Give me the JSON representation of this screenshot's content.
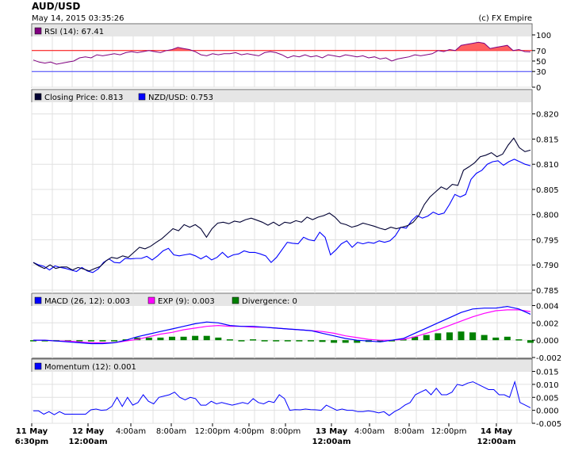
{
  "header": {
    "symbol": "AUD/USD",
    "timestamp": "May 14, 2015 03:35:26",
    "copyright": "(c) FX Empire"
  },
  "panels": {
    "rsi": {
      "legend": "RSI (14): 67.41",
      "ticks": [
        "100",
        "70",
        "50",
        "30",
        "0"
      ],
      "range": [
        0,
        100
      ],
      "levels": [
        70,
        30
      ],
      "colors": {
        "line": "#800080",
        "fill": "#ff6060",
        "upper_level": "#ff0000",
        "lower_level": "#4040ff",
        "swatch": "#800080"
      }
    },
    "price": {
      "legend_closing": "Closing Price: 0.813",
      "legend_nzd": "NZD/USD: 0.753",
      "ticks": [
        "0.820",
        "0.815",
        "0.810",
        "0.805",
        "0.800",
        "0.795",
        "0.790",
        "0.785"
      ],
      "range": [
        0.785,
        0.822
      ],
      "colors": {
        "closing": "#000033",
        "nzd": "#0000ff"
      }
    },
    "macd": {
      "legend_macd": "MACD (26, 12): 0.003",
      "legend_exp": "EXP (9): 0.003",
      "legend_div": "Divergence: 0",
      "ticks": [
        "0.004",
        "0.002",
        "0.000",
        "-0.002"
      ],
      "range": [
        -0.002,
        0.0045
      ],
      "colors": {
        "macd": "#0000ff",
        "exp": "#ff00ff",
        "divergence": "#008000"
      }
    },
    "momentum": {
      "legend": "Momentum (12): 0.001",
      "ticks": [
        "0.015",
        "0.010",
        "0.005",
        "0.000",
        "-0.005"
      ],
      "range": [
        -0.005,
        0.017
      ],
      "colors": {
        "line": "#0000ff"
      }
    }
  },
  "x_axis": {
    "labels": [
      {
        "line1": "11 May",
        "line2": "6:30pm",
        "bold": true
      },
      {
        "line1": "12 May",
        "line2": "12:00am",
        "bold": true
      },
      {
        "line1": "4:00am",
        "line2": "",
        "bold": false
      },
      {
        "line1": "8:00am",
        "line2": "",
        "bold": false
      },
      {
        "line1": "12:00pm",
        "line2": "",
        "bold": false
      },
      {
        "line1": "4:00pm",
        "line2": "",
        "bold": false
      },
      {
        "line1": "8:00pm",
        "line2": "",
        "bold": false
      },
      {
        "line1": "13 May",
        "line2": "12:00am",
        "bold": true
      },
      {
        "line1": "4:00am",
        "line2": "",
        "bold": false
      },
      {
        "line1": "8:00am",
        "line2": "",
        "bold": false
      },
      {
        "line1": "12:00pm",
        "line2": "",
        "bold": false
      },
      {
        "line1": "14 May",
        "line2": "12:00am",
        "bold": true
      }
    ]
  },
  "chart_data": [
    {
      "type": "line",
      "title": "RSI (14): 67.41",
      "ylim": [
        0,
        100
      ],
      "series": [
        {
          "name": "RSI (14)",
          "values": [
            52,
            48,
            46,
            48,
            44,
            46,
            48,
            50,
            56,
            58,
            56,
            62,
            60,
            62,
            64,
            62,
            66,
            68,
            66,
            68,
            70,
            68,
            66,
            70,
            72,
            76,
            74,
            72,
            68,
            62,
            60,
            64,
            62,
            64,
            64,
            66,
            62,
            64,
            62,
            60,
            66,
            68,
            66,
            62,
            56,
            60,
            58,
            62,
            58,
            60,
            56,
            62,
            60,
            58,
            62,
            60,
            58,
            60,
            56,
            58,
            54,
            56,
            50,
            54,
            56,
            58,
            62,
            60,
            62,
            64,
            70,
            68,
            72,
            70,
            80,
            82,
            84,
            86,
            84,
            74,
            76,
            78,
            80,
            70,
            72,
            68,
            67.41
          ]
        }
      ]
    },
    {
      "type": "line",
      "title": "Closing Price: 0.813",
      "ylim": [
        0.785,
        0.822
      ],
      "series": [
        {
          "name": "Closing Price",
          "values": [
            0.7905,
            0.7898,
            0.7893,
            0.79,
            0.7893,
            0.7896,
            0.7896,
            0.789,
            0.7895,
            0.7892,
            0.7888,
            0.7893,
            0.7897,
            0.7908,
            0.7915,
            0.7913,
            0.7918,
            0.7915,
            0.7925,
            0.7935,
            0.7932,
            0.7937,
            0.7945,
            0.7952,
            0.7962,
            0.7972,
            0.7968,
            0.798,
            0.7975,
            0.798,
            0.7972,
            0.7955,
            0.7972,
            0.7983,
            0.7985,
            0.7982,
            0.7987,
            0.7985,
            0.799,
            0.7993,
            0.7989,
            0.7985,
            0.7979,
            0.7985,
            0.7978,
            0.7985,
            0.7983,
            0.7988,
            0.7985,
            0.7995,
            0.799,
            0.7995,
            0.7998,
            0.8003,
            0.7995,
            0.7983,
            0.798,
            0.7975,
            0.7978,
            0.7983,
            0.798,
            0.7977,
            0.7973,
            0.797,
            0.7975,
            0.7972,
            0.7975,
            0.7978,
            0.7985,
            0.7998,
            0.802,
            0.8035,
            0.8045,
            0.8055,
            0.805,
            0.806,
            0.8058,
            0.8088,
            0.8095,
            0.8103,
            0.8115,
            0.8118,
            0.8123,
            0.8115,
            0.812,
            0.8138,
            0.8152,
            0.8133,
            0.8125,
            0.8128
          ]
        },
        {
          "name": "NZD/USD",
          "values": [
            0.7905,
            0.79,
            0.7897,
            0.789,
            0.7898,
            0.7895,
            0.7893,
            0.789,
            0.7887,
            0.7895,
            0.7888,
            0.7885,
            0.7892,
            0.7905,
            0.7912,
            0.7905,
            0.7904,
            0.7913,
            0.7912,
            0.7913,
            0.7913,
            0.7917,
            0.791,
            0.7918,
            0.7928,
            0.7933,
            0.792,
            0.7918,
            0.792,
            0.7922,
            0.7918,
            0.7912,
            0.7918,
            0.791,
            0.7915,
            0.7925,
            0.7915,
            0.792,
            0.7922,
            0.7928,
            0.7925,
            0.7925,
            0.7922,
            0.7918,
            0.7905,
            0.7915,
            0.793,
            0.7945,
            0.7943,
            0.7942,
            0.7955,
            0.795,
            0.7948,
            0.7965,
            0.7955,
            0.792,
            0.793,
            0.7942,
            0.7948,
            0.7935,
            0.7945,
            0.7942,
            0.7945,
            0.7943,
            0.7948,
            0.7945,
            0.7948,
            0.7958,
            0.7975,
            0.7973,
            0.7988,
            0.7998,
            0.7993,
            0.7997,
            0.8005,
            0.8,
            0.8003,
            0.802,
            0.804,
            0.8035,
            0.804,
            0.807,
            0.8082,
            0.8088,
            0.81,
            0.8105,
            0.8107,
            0.8098,
            0.8105,
            0.811,
            0.8105,
            0.81,
            0.8097
          ]
        }
      ]
    },
    {
      "type": "line",
      "title": "MACD (26, 12): 0.003",
      "ylim": [
        -0.002,
        0.0045
      ],
      "series": [
        {
          "name": "MACD (26, 12)",
          "values": [
            0.0,
            0.0,
            -0.0001,
            -0.0002,
            -0.0003,
            -0.0004,
            -0.0004,
            -0.0003,
            0.0,
            0.0004,
            0.0007,
            0.001,
            0.0013,
            0.0016,
            0.0019,
            0.0021,
            0.002,
            0.0017,
            0.0016,
            0.0016,
            0.0015,
            0.0014,
            0.0013,
            0.0012,
            0.0011,
            0.0008,
            0.0005,
            0.0002,
            0.0,
            -0.0001,
            -0.0002,
            0.0,
            0.0002,
            0.0008,
            0.0014,
            0.002,
            0.0026,
            0.0032,
            0.0036,
            0.0037,
            0.0037,
            0.0039,
            0.0036,
            0.003
          ]
        },
        {
          "name": "EXP (9)",
          "values": [
            0.0,
            0.0,
            -0.0001,
            -0.0001,
            -0.0002,
            -0.0003,
            -0.0003,
            -0.0003,
            -0.0001,
            0.0001,
            0.0004,
            0.0007,
            0.0009,
            0.0012,
            0.0014,
            0.0016,
            0.0017,
            0.0016,
            0.0016,
            0.0015,
            0.0015,
            0.0014,
            0.0013,
            0.0012,
            0.0011,
            0.001,
            0.0008,
            0.0005,
            0.0003,
            0.0001,
            0.0,
            0.0,
            0.0001,
            0.0004,
            0.0008,
            0.0012,
            0.0017,
            0.0022,
            0.0027,
            0.0031,
            0.0034,
            0.0035,
            0.0035,
            0.0033
          ]
        },
        {
          "name": "Divergence",
          "values": [
            0.0,
            0.0,
            0.0,
            -0.0001,
            -0.0001,
            -0.0001,
            -0.0001,
            0.0,
            0.0001,
            0.0003,
            0.0003,
            0.0003,
            0.0004,
            0.0004,
            0.0005,
            0.0005,
            0.0003,
            0.0001,
            0.0,
            0.0001,
            0.0,
            0.0,
            0.0,
            0.0,
            0.0,
            -0.0002,
            -0.0003,
            -0.0003,
            -0.0003,
            -0.0002,
            -0.0002,
            0.0,
            0.0001,
            0.0004,
            0.0006,
            0.0008,
            0.0009,
            0.001,
            0.0009,
            0.0006,
            0.0003,
            0.0004,
            0.0001,
            -0.0003
          ]
        }
      ]
    },
    {
      "type": "line",
      "title": "Momentum (12): 0.001",
      "ylim": [
        -0.005,
        0.017
      ],
      "series": [
        {
          "name": "Momentum (12)",
          "values": [
            -0.0002,
            -0.0002,
            -0.0015,
            -0.0005,
            -0.0017,
            -0.0005,
            -0.0015,
            -0.0015,
            -0.0015,
            -0.0015,
            -0.0015,
            0.0002,
            0.0005,
            0.0,
            0.0002,
            0.0015,
            0.005,
            0.0015,
            0.005,
            0.002,
            0.003,
            0.006,
            0.0035,
            0.0025,
            0.005,
            0.0055,
            0.006,
            0.007,
            0.005,
            0.004,
            0.005,
            0.0045,
            0.002,
            0.002,
            0.0035,
            0.0025,
            0.003,
            0.0025,
            0.002,
            0.0025,
            0.003,
            0.0025,
            0.0045,
            0.003,
            0.0025,
            0.0035,
            0.003,
            0.006,
            0.0045,
            0.0,
            0.0003,
            0.0002,
            0.0005,
            0.0003,
            0.0002,
            0.0,
            0.002,
            0.001,
            0.0,
            0.0005,
            0.0,
            0.0,
            -0.0005,
            -0.0005,
            -0.0002,
            -0.0005,
            -0.001,
            -0.0005,
            -0.002,
            -0.0005,
            0.0005,
            0.002,
            0.003,
            0.006,
            0.007,
            0.008,
            0.006,
            0.0085,
            0.006,
            0.006,
            0.007,
            0.01,
            0.0095,
            0.0105,
            0.011,
            0.01,
            0.009,
            0.008,
            0.008,
            0.006,
            0.006,
            0.005,
            0.011,
            0.003,
            0.002,
            0.001
          ]
        }
      ]
    }
  ]
}
